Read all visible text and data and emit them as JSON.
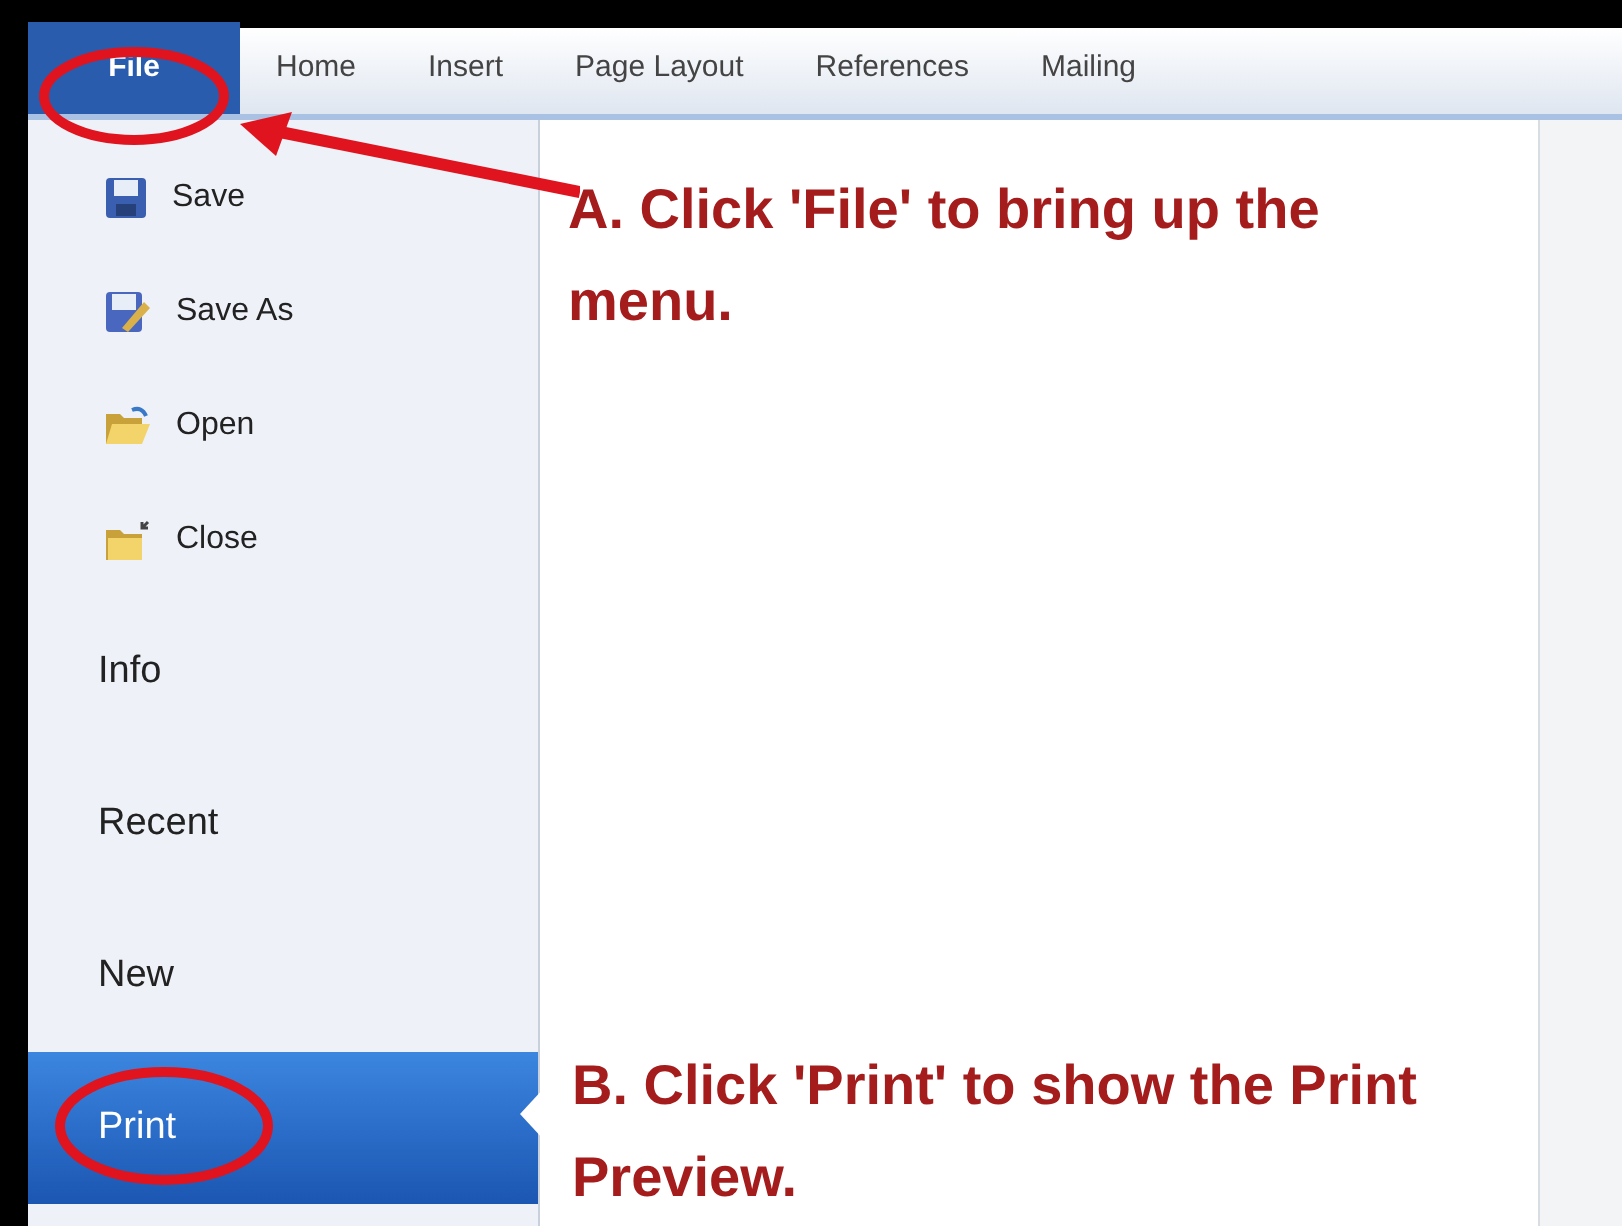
{
  "tabs": [
    {
      "label": "File",
      "selected": true,
      "kind": "file"
    },
    {
      "label": "Home",
      "selected": false,
      "kind": "tab"
    },
    {
      "label": "Insert",
      "selected": false,
      "kind": "tab"
    },
    {
      "label": "Page Layout",
      "selected": false,
      "kind": "tab"
    },
    {
      "label": "References",
      "selected": false,
      "kind": "tab"
    },
    {
      "label": "Mailing",
      "selected": false,
      "kind": "tab"
    }
  ],
  "menu": [
    {
      "label": "Save",
      "kind": "command",
      "selected": false
    },
    {
      "label": "Save As",
      "kind": "command",
      "selected": false
    },
    {
      "label": "Open",
      "kind": "command",
      "selected": false
    },
    {
      "label": "Close",
      "kind": "command",
      "selected": false
    },
    {
      "label": "Info",
      "kind": "page",
      "selected": false
    },
    {
      "label": "Recent",
      "kind": "page",
      "selected": false
    },
    {
      "label": "New",
      "kind": "page",
      "selected": false
    },
    {
      "label": "Print",
      "kind": "page",
      "selected": true
    }
  ],
  "annotations": [
    {
      "text": "A. Click 'File' to bring up the menu."
    },
    {
      "text": "B. Click 'Print' to show the Print Preview."
    }
  ]
}
